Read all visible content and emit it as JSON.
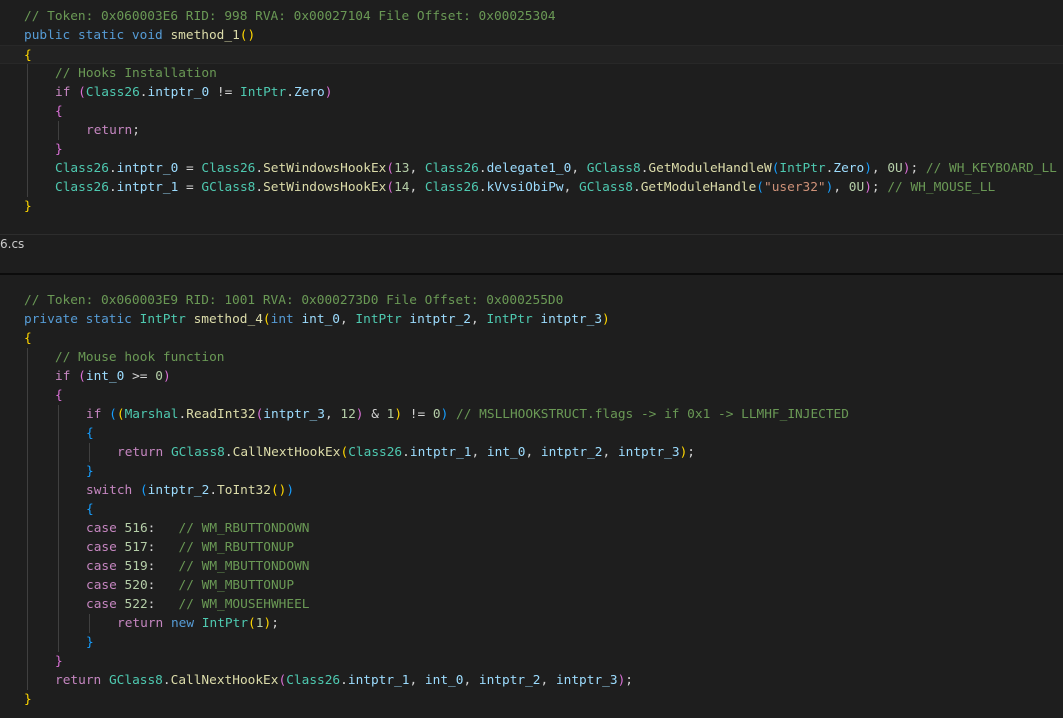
{
  "panel1": {
    "lines": [
      {
        "indent": 0,
        "tokens": [
          {
            "t": "// Token: 0x060003E6 RID: 998 RVA: 0x00027104 File Offset: 0x00025304",
            "c": "cm"
          }
        ]
      },
      {
        "indent": 0,
        "tokens": [
          {
            "t": "public",
            "c": "kw"
          },
          {
            "t": " ",
            "c": "pl"
          },
          {
            "t": "static",
            "c": "kw"
          },
          {
            "t": " ",
            "c": "pl"
          },
          {
            "t": "void",
            "c": "kw"
          },
          {
            "t": " ",
            "c": "pl"
          },
          {
            "t": "smethod_1",
            "c": "fn"
          },
          {
            "t": "()",
            "c": "p1"
          }
        ]
      },
      {
        "indent": 0,
        "active": true,
        "tokens": [
          {
            "t": "{",
            "c": "p1"
          }
        ]
      },
      {
        "indent": 1,
        "tokens": [
          {
            "t": "// Hooks Installation",
            "c": "cm"
          }
        ]
      },
      {
        "indent": 1,
        "tokens": [
          {
            "t": "if",
            "c": "ctl"
          },
          {
            "t": " ",
            "c": "pl"
          },
          {
            "t": "(",
            "c": "p2"
          },
          {
            "t": "Class26",
            "c": "ty"
          },
          {
            "t": ".",
            "c": "pl"
          },
          {
            "t": "intptr_0",
            "c": "var"
          },
          {
            "t": " != ",
            "c": "pl"
          },
          {
            "t": "IntPtr",
            "c": "ty"
          },
          {
            "t": ".",
            "c": "pl"
          },
          {
            "t": "Zero",
            "c": "var"
          },
          {
            "t": ")",
            "c": "p2"
          }
        ]
      },
      {
        "indent": 1,
        "tokens": [
          {
            "t": "{",
            "c": "p2"
          }
        ]
      },
      {
        "indent": 2,
        "tokens": [
          {
            "t": "return",
            "c": "ctl"
          },
          {
            "t": ";",
            "c": "pl"
          }
        ]
      },
      {
        "indent": 1,
        "tokens": [
          {
            "t": "}",
            "c": "p2"
          }
        ]
      },
      {
        "indent": 1,
        "tokens": [
          {
            "t": "Class26",
            "c": "ty"
          },
          {
            "t": ".",
            "c": "pl"
          },
          {
            "t": "intptr_0",
            "c": "var"
          },
          {
            "t": " = ",
            "c": "pl"
          },
          {
            "t": "Class26",
            "c": "ty"
          },
          {
            "t": ".",
            "c": "pl"
          },
          {
            "t": "SetWindowsHookEx",
            "c": "fn"
          },
          {
            "t": "(",
            "c": "p2"
          },
          {
            "t": "13",
            "c": "num"
          },
          {
            "t": ", ",
            "c": "pl"
          },
          {
            "t": "Class26",
            "c": "ty"
          },
          {
            "t": ".",
            "c": "pl"
          },
          {
            "t": "delegate1_0",
            "c": "var"
          },
          {
            "t": ", ",
            "c": "pl"
          },
          {
            "t": "GClass8",
            "c": "ty"
          },
          {
            "t": ".",
            "c": "pl"
          },
          {
            "t": "GetModuleHandleW",
            "c": "fn"
          },
          {
            "t": "(",
            "c": "p3"
          },
          {
            "t": "IntPtr",
            "c": "ty"
          },
          {
            "t": ".",
            "c": "pl"
          },
          {
            "t": "Zero",
            "c": "var"
          },
          {
            "t": ")",
            "c": "p3"
          },
          {
            "t": ", ",
            "c": "pl"
          },
          {
            "t": "0U",
            "c": "num"
          },
          {
            "t": ")",
            "c": "p2"
          },
          {
            "t": "; ",
            "c": "pl"
          },
          {
            "t": "// WH_KEYBOARD_LL",
            "c": "cm"
          }
        ]
      },
      {
        "indent": 1,
        "tokens": [
          {
            "t": "Class26",
            "c": "ty"
          },
          {
            "t": ".",
            "c": "pl"
          },
          {
            "t": "intptr_1",
            "c": "var"
          },
          {
            "t": " = ",
            "c": "pl"
          },
          {
            "t": "GClass8",
            "c": "ty"
          },
          {
            "t": ".",
            "c": "pl"
          },
          {
            "t": "SetWindowsHookEx",
            "c": "fn"
          },
          {
            "t": "(",
            "c": "p2"
          },
          {
            "t": "14",
            "c": "num"
          },
          {
            "t": ", ",
            "c": "pl"
          },
          {
            "t": "Class26",
            "c": "ty"
          },
          {
            "t": ".",
            "c": "pl"
          },
          {
            "t": "kVvsiObiPw",
            "c": "var"
          },
          {
            "t": ", ",
            "c": "pl"
          },
          {
            "t": "GClass8",
            "c": "ty"
          },
          {
            "t": ".",
            "c": "pl"
          },
          {
            "t": "GetModuleHandle",
            "c": "fn"
          },
          {
            "t": "(",
            "c": "p3"
          },
          {
            "t": "\"user32\"",
            "c": "str"
          },
          {
            "t": ")",
            "c": "p3"
          },
          {
            "t": ", ",
            "c": "pl"
          },
          {
            "t": "0U",
            "c": "num"
          },
          {
            "t": ")",
            "c": "p2"
          },
          {
            "t": "; ",
            "c": "pl"
          },
          {
            "t": "// WH_MOUSE_LL",
            "c": "cm"
          }
        ]
      },
      {
        "indent": 0,
        "tokens": [
          {
            "t": "}",
            "c": "p1"
          }
        ]
      }
    ]
  },
  "tab": {
    "filename": "6.cs"
  },
  "panel2": {
    "lines": [
      {
        "indent": 0,
        "tokens": [
          {
            "t": "// Token: 0x060003E9 RID: 1001 RVA: 0x000273D0 File Offset: 0x000255D0",
            "c": "cm"
          }
        ]
      },
      {
        "indent": 0,
        "tokens": [
          {
            "t": "private",
            "c": "kw"
          },
          {
            "t": " ",
            "c": "pl"
          },
          {
            "t": "static",
            "c": "kw"
          },
          {
            "t": " ",
            "c": "pl"
          },
          {
            "t": "IntPtr",
            "c": "ty"
          },
          {
            "t": " ",
            "c": "pl"
          },
          {
            "t": "smethod_4",
            "c": "fn"
          },
          {
            "t": "(",
            "c": "p1"
          },
          {
            "t": "int",
            "c": "kw"
          },
          {
            "t": " ",
            "c": "pl"
          },
          {
            "t": "int_0",
            "c": "var"
          },
          {
            "t": ", ",
            "c": "pl"
          },
          {
            "t": "IntPtr",
            "c": "ty"
          },
          {
            "t": " ",
            "c": "pl"
          },
          {
            "t": "intptr_2",
            "c": "var"
          },
          {
            "t": ", ",
            "c": "pl"
          },
          {
            "t": "IntPtr",
            "c": "ty"
          },
          {
            "t": " ",
            "c": "pl"
          },
          {
            "t": "intptr_3",
            "c": "var"
          },
          {
            "t": ")",
            "c": "p1"
          }
        ]
      },
      {
        "indent": 0,
        "tokens": [
          {
            "t": "{",
            "c": "p1"
          }
        ]
      },
      {
        "indent": 1,
        "tokens": [
          {
            "t": "// Mouse hook function",
            "c": "cm"
          }
        ]
      },
      {
        "indent": 1,
        "tokens": [
          {
            "t": "if",
            "c": "ctl"
          },
          {
            "t": " ",
            "c": "pl"
          },
          {
            "t": "(",
            "c": "p2"
          },
          {
            "t": "int_0",
            "c": "var"
          },
          {
            "t": " >= ",
            "c": "pl"
          },
          {
            "t": "0",
            "c": "num"
          },
          {
            "t": ")",
            "c": "p2"
          }
        ]
      },
      {
        "indent": 1,
        "tokens": [
          {
            "t": "{",
            "c": "p2"
          }
        ]
      },
      {
        "indent": 2,
        "tokens": [
          {
            "t": "if",
            "c": "ctl"
          },
          {
            "t": " ",
            "c": "pl"
          },
          {
            "t": "(",
            "c": "p3"
          },
          {
            "t": "(",
            "c": "p1"
          },
          {
            "t": "Marshal",
            "c": "ty"
          },
          {
            "t": ".",
            "c": "pl"
          },
          {
            "t": "ReadInt32",
            "c": "fn"
          },
          {
            "t": "(",
            "c": "p2"
          },
          {
            "t": "intptr_3",
            "c": "var"
          },
          {
            "t": ", ",
            "c": "pl"
          },
          {
            "t": "12",
            "c": "num"
          },
          {
            "t": ")",
            "c": "p2"
          },
          {
            "t": " & ",
            "c": "pl"
          },
          {
            "t": "1",
            "c": "num"
          },
          {
            "t": ")",
            "c": "p1"
          },
          {
            "t": " != ",
            "c": "pl"
          },
          {
            "t": "0",
            "c": "num"
          },
          {
            "t": ")",
            "c": "p3"
          },
          {
            "t": " ",
            "c": "pl"
          },
          {
            "t": "// MSLLHOOKSTRUCT.flags -> if 0x1 -> LLMHF_INJECTED",
            "c": "cm"
          }
        ]
      },
      {
        "indent": 2,
        "tokens": [
          {
            "t": "{",
            "c": "p3"
          }
        ]
      },
      {
        "indent": 3,
        "tokens": [
          {
            "t": "return",
            "c": "ctl"
          },
          {
            "t": " ",
            "c": "pl"
          },
          {
            "t": "GClass8",
            "c": "ty"
          },
          {
            "t": ".",
            "c": "pl"
          },
          {
            "t": "CallNextHookEx",
            "c": "fn"
          },
          {
            "t": "(",
            "c": "p1"
          },
          {
            "t": "Class26",
            "c": "ty"
          },
          {
            "t": ".",
            "c": "pl"
          },
          {
            "t": "intptr_1",
            "c": "var"
          },
          {
            "t": ", ",
            "c": "pl"
          },
          {
            "t": "int_0",
            "c": "var"
          },
          {
            "t": ", ",
            "c": "pl"
          },
          {
            "t": "intptr_2",
            "c": "var"
          },
          {
            "t": ", ",
            "c": "pl"
          },
          {
            "t": "intptr_3",
            "c": "var"
          },
          {
            "t": ")",
            "c": "p1"
          },
          {
            "t": ";",
            "c": "pl"
          }
        ]
      },
      {
        "indent": 2,
        "tokens": [
          {
            "t": "}",
            "c": "p3"
          }
        ]
      },
      {
        "indent": 2,
        "tokens": [
          {
            "t": "switch",
            "c": "ctl"
          },
          {
            "t": " ",
            "c": "pl"
          },
          {
            "t": "(",
            "c": "p3"
          },
          {
            "t": "intptr_2",
            "c": "var"
          },
          {
            "t": ".",
            "c": "pl"
          },
          {
            "t": "ToInt32",
            "c": "fn"
          },
          {
            "t": "()",
            "c": "p1"
          },
          {
            "t": ")",
            "c": "p3"
          }
        ]
      },
      {
        "indent": 2,
        "tokens": [
          {
            "t": "{",
            "c": "p3"
          }
        ]
      },
      {
        "indent": 2,
        "tokens": [
          {
            "t": "case",
            "c": "ctl"
          },
          {
            "t": " ",
            "c": "pl"
          },
          {
            "t": "516",
            "c": "num"
          },
          {
            "t": ":   ",
            "c": "pl"
          },
          {
            "t": "// WM_RBUTTONDOWN",
            "c": "cm"
          }
        ]
      },
      {
        "indent": 2,
        "tokens": [
          {
            "t": "case",
            "c": "ctl"
          },
          {
            "t": " ",
            "c": "pl"
          },
          {
            "t": "517",
            "c": "num"
          },
          {
            "t": ":   ",
            "c": "pl"
          },
          {
            "t": "// WM_RBUTTONUP",
            "c": "cm"
          }
        ]
      },
      {
        "indent": 2,
        "tokens": [
          {
            "t": "case",
            "c": "ctl"
          },
          {
            "t": " ",
            "c": "pl"
          },
          {
            "t": "519",
            "c": "num"
          },
          {
            "t": ":   ",
            "c": "pl"
          },
          {
            "t": "// WM_MBUTTONDOWN",
            "c": "cm"
          }
        ]
      },
      {
        "indent": 2,
        "tokens": [
          {
            "t": "case",
            "c": "ctl"
          },
          {
            "t": " ",
            "c": "pl"
          },
          {
            "t": "520",
            "c": "num"
          },
          {
            "t": ":   ",
            "c": "pl"
          },
          {
            "t": "// WM_MBUTTONUP",
            "c": "cm"
          }
        ]
      },
      {
        "indent": 2,
        "tokens": [
          {
            "t": "case",
            "c": "ctl"
          },
          {
            "t": " ",
            "c": "pl"
          },
          {
            "t": "522",
            "c": "num"
          },
          {
            "t": ":   ",
            "c": "pl"
          },
          {
            "t": "// WM_MOUSEHWHEEL",
            "c": "cm"
          }
        ]
      },
      {
        "indent": 3,
        "tokens": [
          {
            "t": "return",
            "c": "ctl"
          },
          {
            "t": " ",
            "c": "pl"
          },
          {
            "t": "new",
            "c": "kw"
          },
          {
            "t": " ",
            "c": "pl"
          },
          {
            "t": "IntPtr",
            "c": "ty"
          },
          {
            "t": "(",
            "c": "p1"
          },
          {
            "t": "1",
            "c": "num"
          },
          {
            "t": ")",
            "c": "p1"
          },
          {
            "t": ";",
            "c": "pl"
          }
        ]
      },
      {
        "indent": 2,
        "tokens": [
          {
            "t": "}",
            "c": "p3"
          }
        ]
      },
      {
        "indent": 1,
        "tokens": [
          {
            "t": "}",
            "c": "p2"
          }
        ]
      },
      {
        "indent": 1,
        "tokens": [
          {
            "t": "return",
            "c": "ctl"
          },
          {
            "t": " ",
            "c": "pl"
          },
          {
            "t": "GClass8",
            "c": "ty"
          },
          {
            "t": ".",
            "c": "pl"
          },
          {
            "t": "CallNextHookEx",
            "c": "fn"
          },
          {
            "t": "(",
            "c": "p2"
          },
          {
            "t": "Class26",
            "c": "ty"
          },
          {
            "t": ".",
            "c": "pl"
          },
          {
            "t": "intptr_1",
            "c": "var"
          },
          {
            "t": ", ",
            "c": "pl"
          },
          {
            "t": "int_0",
            "c": "var"
          },
          {
            "t": ", ",
            "c": "pl"
          },
          {
            "t": "intptr_2",
            "c": "var"
          },
          {
            "t": ", ",
            "c": "pl"
          },
          {
            "t": "intptr_3",
            "c": "var"
          },
          {
            "t": ")",
            "c": "p2"
          },
          {
            "t": ";",
            "c": "pl"
          }
        ]
      },
      {
        "indent": 0,
        "tokens": [
          {
            "t": "}",
            "c": "p1"
          }
        ]
      }
    ]
  }
}
